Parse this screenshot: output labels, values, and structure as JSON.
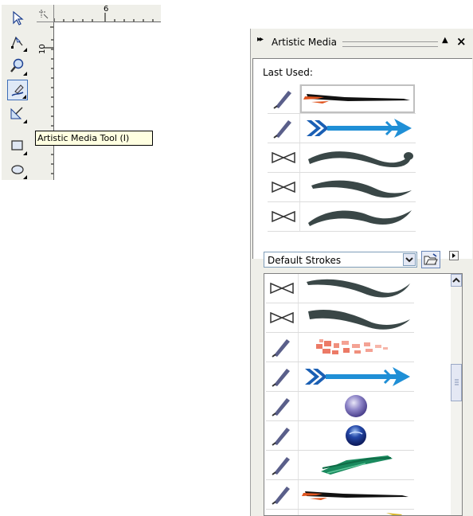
{
  "toolbox": {
    "tools": [
      {
        "name": "pick-tool",
        "icon": "arrow-pointer-icon"
      },
      {
        "name": "shape-tool",
        "icon": "node-edit-icon"
      },
      {
        "name": "zoom-tool",
        "icon": "magnifier-icon"
      },
      {
        "name": "artistic-media-tool",
        "icon": "brush-pen-icon",
        "active": true
      },
      {
        "name": "smart-fill-tool",
        "icon": "smart-fill-icon"
      },
      {
        "name": "rectangle-tool",
        "icon": "rectangle-icon"
      },
      {
        "name": "ellipse-tool",
        "icon": "ellipse-icon"
      }
    ]
  },
  "rulers": {
    "top_label": "6",
    "left_label": "10"
  },
  "tooltip": {
    "text": "Artistic Media Tool (I)"
  },
  "docker": {
    "title": "Artistic Media",
    "last_used_label": "Last Used:",
    "last_used": [
      {
        "icon": "brush-icon",
        "stroke": "streak-black-red"
      },
      {
        "icon": "brush-icon",
        "stroke": "arrow-blue"
      },
      {
        "icon": "bowtie-icon",
        "stroke": "wave-dark-1"
      },
      {
        "icon": "bowtie-icon",
        "stroke": "wave-dark-2"
      },
      {
        "icon": "bowtie-icon",
        "stroke": "wave-dark-3"
      }
    ],
    "preset_select": {
      "value": "Default Strokes"
    },
    "strokes": [
      {
        "icon": "bowtie-icon",
        "stroke": "wave-dark-4"
      },
      {
        "icon": "bowtie-icon",
        "stroke": "wave-dark-5"
      },
      {
        "icon": "brush-icon",
        "stroke": "splatter-salmon"
      },
      {
        "icon": "brush-icon",
        "stroke": "arrow-blue"
      },
      {
        "icon": "brush-icon",
        "stroke": "sphere-purple"
      },
      {
        "icon": "brush-icon",
        "stroke": "sphere-blue"
      },
      {
        "icon": "brush-icon",
        "stroke": "streak-green"
      },
      {
        "icon": "brush-icon",
        "stroke": "streak-black-red"
      },
      {
        "icon": "brush-icon",
        "stroke": "streak-yellow"
      }
    ]
  },
  "colors": {
    "arrow_blue": "#1f8fd6",
    "chevron_blue": "#1a5fb4",
    "wave_dark": "#3a4747",
    "salmon": "#ec7a66",
    "green_streak": "#1a8a5e",
    "selection_blue": "#3c6db8"
  }
}
